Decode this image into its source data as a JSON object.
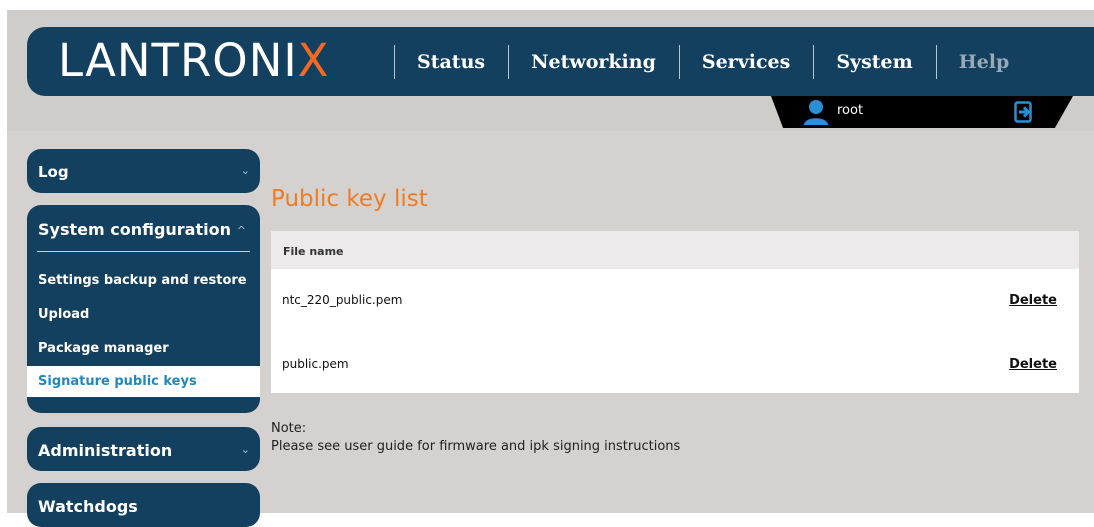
{
  "brand": {
    "logo_main": "LANTRONI",
    "logo_accent": "X",
    "accent_color": "#f26a21",
    "primary_color": "#14405f"
  },
  "nav": {
    "items": [
      {
        "label": "Status"
      },
      {
        "label": "Networking"
      },
      {
        "label": "Services"
      },
      {
        "label": "System"
      },
      {
        "label": "Help"
      }
    ]
  },
  "user": {
    "name": "root",
    "icon": "user-icon",
    "logout_icon": "logout-icon"
  },
  "sidebar": {
    "log": {
      "label": "Log",
      "icon": "chevron-down-icon"
    },
    "system_configuration": {
      "label": "System configuration",
      "icon": "chevron-up-icon",
      "items": [
        {
          "label": "Settings backup and restore"
        },
        {
          "label": "Upload"
        },
        {
          "label": "Package manager"
        },
        {
          "label": "Signature public keys",
          "active": true
        }
      ]
    },
    "administration": {
      "label": "Administration",
      "icon": "chevron-down-icon"
    },
    "watchdogs": {
      "label": "Watchdogs"
    }
  },
  "main": {
    "title": "Public key list",
    "table": {
      "header": "File name",
      "rows": [
        {
          "file": "ntc_220_public.pem",
          "action": "Delete"
        },
        {
          "file": "public.pem",
          "action": "Delete"
        }
      ]
    },
    "note_label": "Note:",
    "note_text": "Please see user guide for firmware and ipk signing instructions"
  }
}
